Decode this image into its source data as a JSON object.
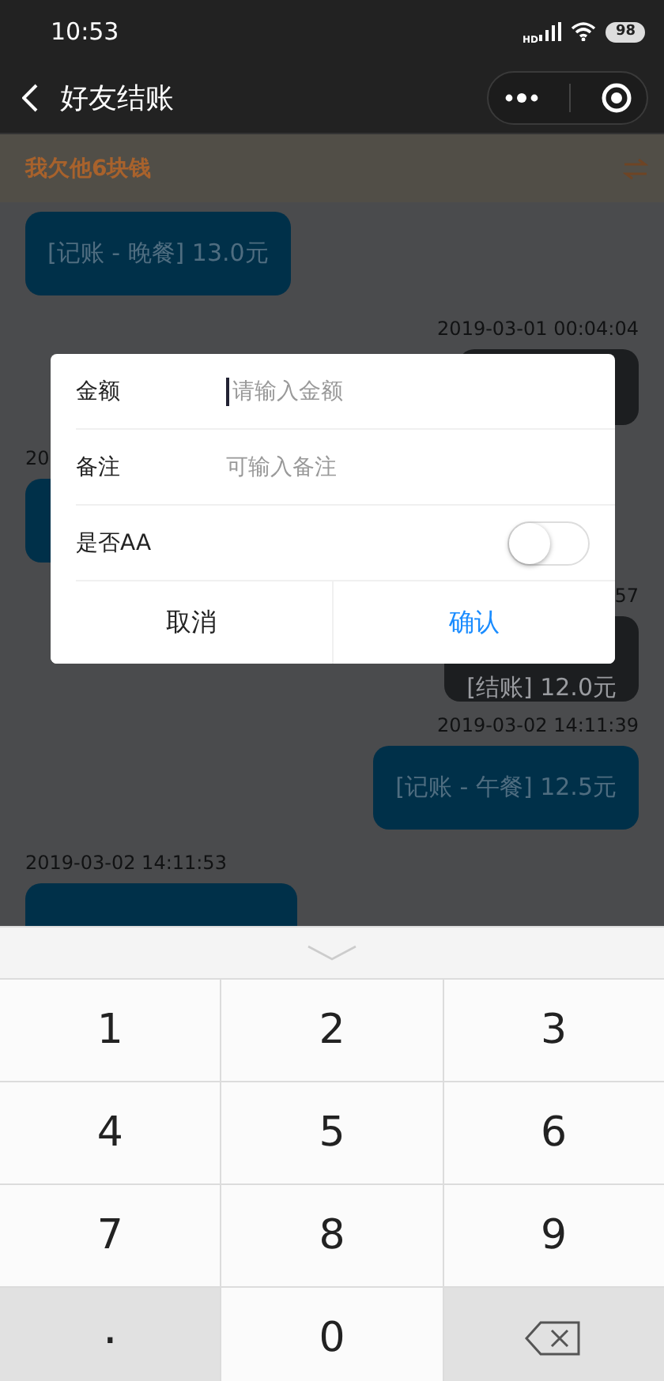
{
  "status_bar": {
    "time": "10:53",
    "network": "HD",
    "battery": "98"
  },
  "header": {
    "title": "好友结账"
  },
  "banner": {
    "text": "我欠他6块钱"
  },
  "messages": [
    {
      "kind": "record",
      "outgoing": false,
      "text": "[记账 - 晚餐] 13.0元"
    },
    {
      "kind": "time",
      "outgoing": true,
      "text": "2019-03-01 00:04:04"
    },
    {
      "kind": "settle",
      "outgoing": true
    },
    {
      "kind": "time",
      "outgoing": false,
      "text": "20"
    },
    {
      "kind": "record",
      "outgoing": false
    },
    {
      "kind": "time",
      "outgoing": true,
      "text": "57"
    },
    {
      "kind": "settle",
      "outgoing": true,
      "text": "[结账] 12.0元"
    },
    {
      "kind": "time",
      "outgoing": true,
      "text": "2019-03-02 14:11:39"
    },
    {
      "kind": "record",
      "outgoing": true,
      "text": "[记账 - 午餐] 12.5元"
    },
    {
      "kind": "time",
      "outgoing": false,
      "text": "2019-03-02 14:11:53"
    },
    {
      "kind": "record",
      "outgoing": false
    }
  ],
  "dialog": {
    "fields": [
      {
        "label": "金额",
        "placeholder": "请输入金额",
        "focused": true
      },
      {
        "label": "备注",
        "placeholder": "可输入备注",
        "focused": false
      }
    ],
    "toggle": {
      "label": "是否AA",
      "on": false
    },
    "buttons": [
      {
        "label": "取消",
        "kind": "cancel"
      },
      {
        "label": "确认",
        "kind": "confirm"
      }
    ]
  },
  "keypad": {
    "keys": [
      {
        "kind": "digit",
        "label": "1"
      },
      {
        "kind": "digit",
        "label": "2"
      },
      {
        "kind": "digit",
        "label": "3"
      },
      {
        "kind": "digit",
        "label": "4"
      },
      {
        "kind": "digit",
        "label": "5"
      },
      {
        "kind": "digit",
        "label": "6"
      },
      {
        "kind": "digit",
        "label": "7"
      },
      {
        "kind": "digit",
        "label": "8"
      },
      {
        "kind": "digit",
        "label": "9"
      },
      {
        "kind": "function",
        "label": "."
      },
      {
        "kind": "digit",
        "label": "0"
      },
      {
        "kind": "delete"
      }
    ]
  }
}
